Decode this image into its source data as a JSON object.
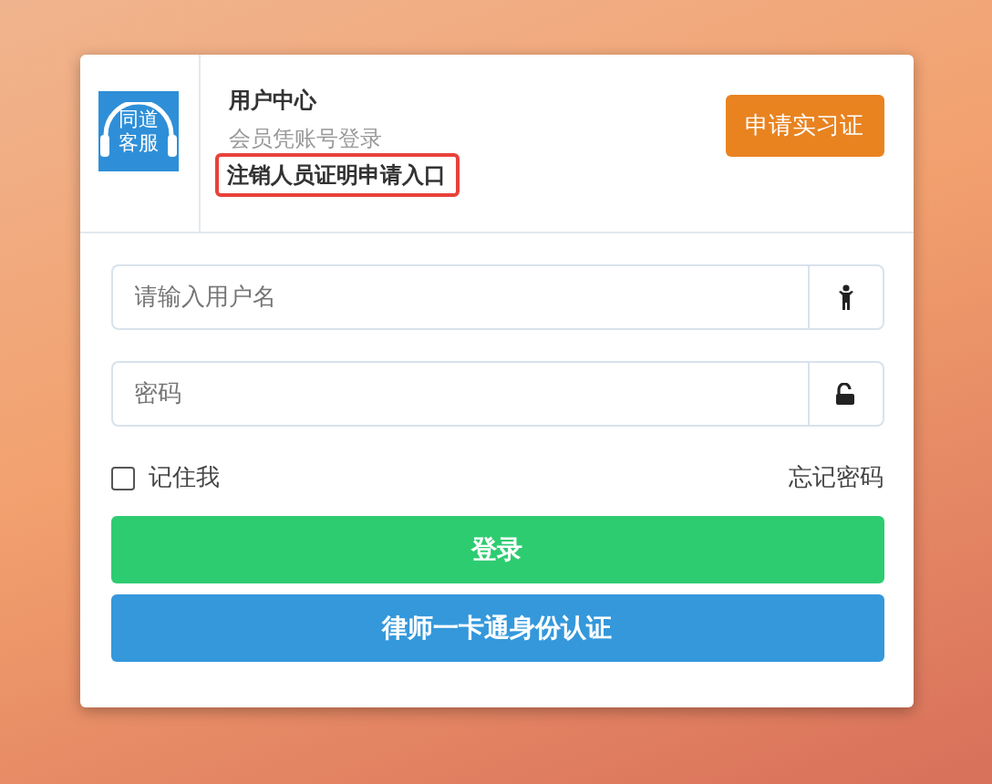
{
  "logo": {
    "lines": [
      "同道",
      "客服"
    ]
  },
  "header": {
    "title": "用户中心",
    "subtitle": "会员凭账号登录",
    "link": "注销人员证明申请入口",
    "button": "申请实习证"
  },
  "form": {
    "username": {
      "placeholder": "请输入用户名"
    },
    "password": {
      "placeholder": "密码"
    },
    "remember": {
      "label": "记住我",
      "checked": false
    },
    "forgot": "忘记密码",
    "login_button": "登录",
    "card_button": "律师一卡通身份认证"
  }
}
